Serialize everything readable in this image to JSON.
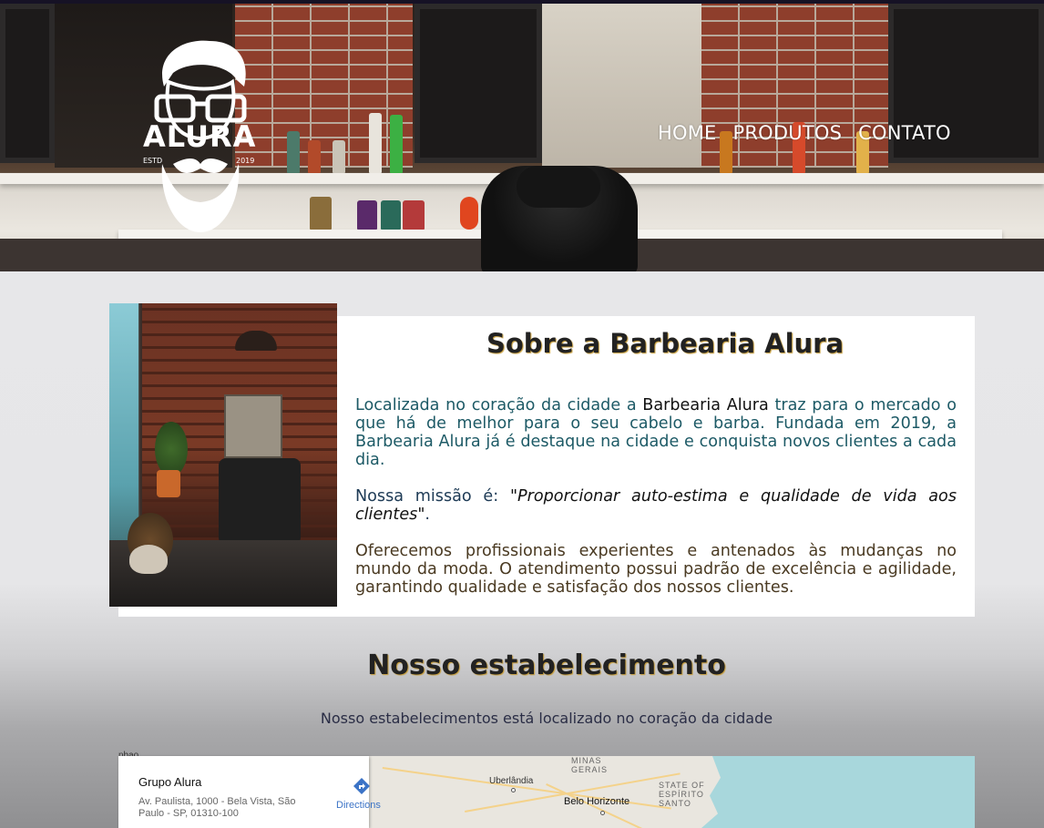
{
  "brand": {
    "name": "ALURA",
    "est": "ESTD",
    "year": "2019"
  },
  "nav": {
    "items": [
      "HOME",
      "PRODUTOS",
      "CONTATO"
    ]
  },
  "about": {
    "title": "Sobre a Barbearia Alura",
    "p1_pre": "Localizada no coração da cidade a ",
    "p1_strong": "Barbearia Alura",
    "p1_post": " traz para o mercado o que há de melhor para o seu cabelo e barba. Fundada em 2019, a Barbearia Alura já é destaque na cidade e conquista novos clientes a cada dia.",
    "p2_pre": "Nossa missão é: ",
    "p2_quote": "\"Proporcionar auto-estima e qualidade de vida aos clientes\"",
    "p2_post": ".",
    "p3": "Oferecemos profissionais experientes e antenados às mudanças no mundo da moda. O atendimento possui padrão de excelência e agilidade, garantindo qualidade e satisfação dos nossos clientes."
  },
  "establishment": {
    "title": "Nosso estabelecimento",
    "subtitle": "Nosso estabelecimentos está localizado no coração da cidade"
  },
  "map": {
    "place_name": "Grupo Alura",
    "address": "Av. Paulista, 1000 - Bela Vista, São Paulo - SP, 01310-100",
    "directions_label": "Directions",
    "labels": {
      "minas_gerais": "MINAS\nGERAIS",
      "uberlandia": "Uberlândia",
      "belo_horizonte": "Belo Horizonte",
      "espirito_santo": "STATE OF\nESPÍRITO\nSANTO",
      "partial": "nbao"
    }
  },
  "colors": {
    "gold_shadow": "#c49a35",
    "dark_bar": "#161225",
    "directions_blue": "#3b73c6"
  }
}
